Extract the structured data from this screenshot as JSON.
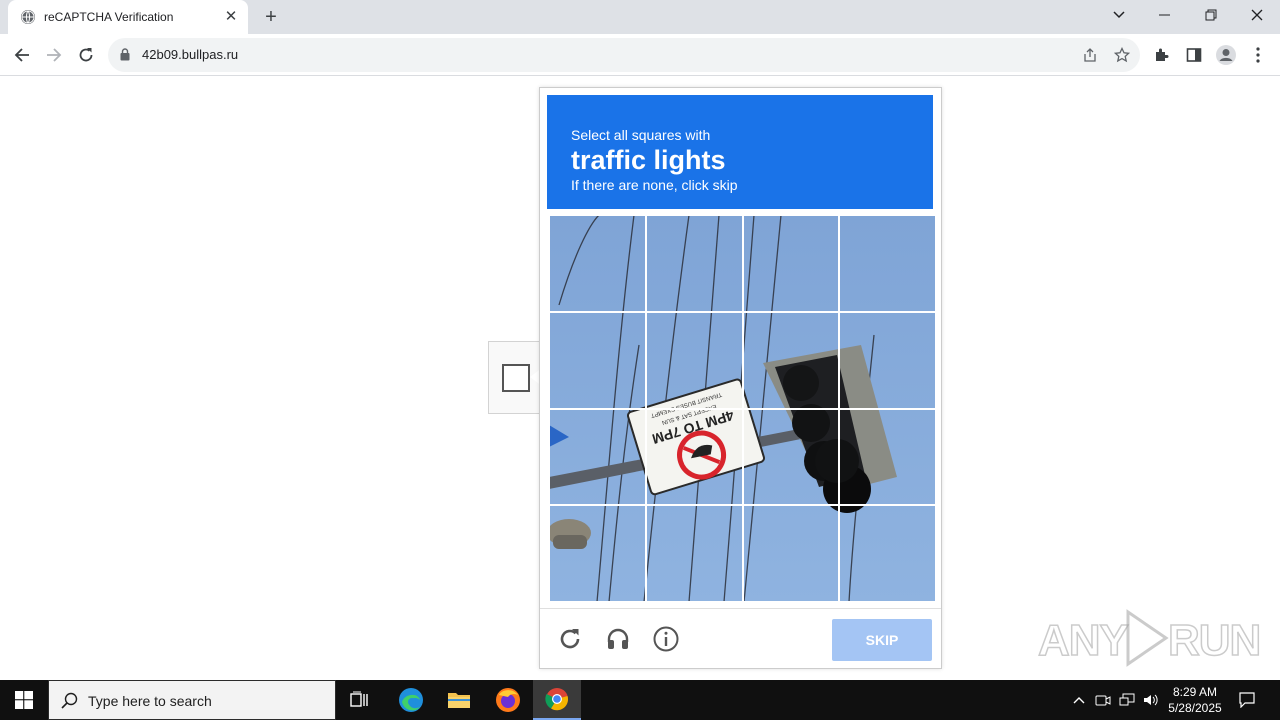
{
  "browser": {
    "tab_title": "reCAPTCHA Verification",
    "url": "42b09.bullpas.ru"
  },
  "captcha": {
    "prompt_intro": "Select all squares with",
    "prompt_target": "traffic lights",
    "prompt_sub": "If there are none, click skip",
    "skip_label": "SKIP",
    "grid_rows": 4,
    "grid_cols": 4,
    "image_sign_text": "4PM TO 7PM EXCEPT SAT & SUN TRANSIT BUSES EXEMPT",
    "colors": {
      "prompt_bg": "#1a73e8",
      "skip_bg": "#a4c5f4",
      "sky": "#8fb1dc"
    }
  },
  "watermark": {
    "text": "ANY RUN"
  },
  "taskbar": {
    "search_placeholder": "Type here to search",
    "time": "8:29 AM",
    "date": "5/28/2025"
  }
}
